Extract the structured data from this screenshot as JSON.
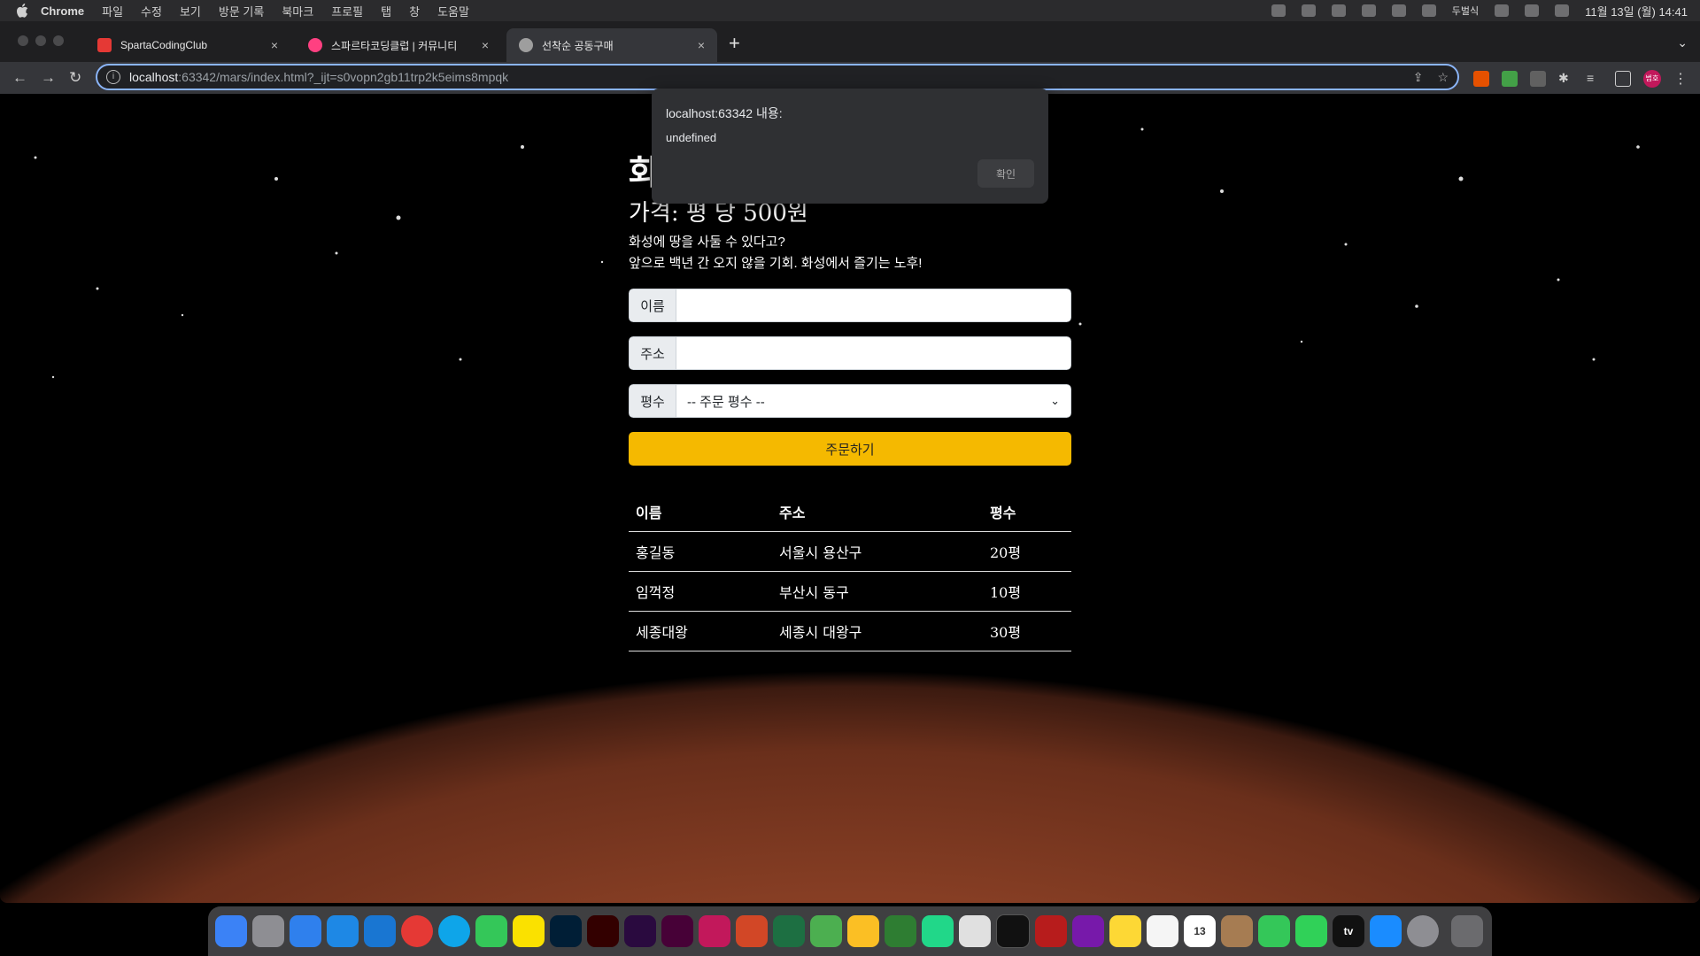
{
  "menubar": {
    "app": "Chrome",
    "items": [
      "파일",
      "수정",
      "보기",
      "방문 기록",
      "북마크",
      "프로필",
      "탭",
      "창",
      "도움말"
    ],
    "input_source": "두벌식",
    "clock": "11월 13일 (월) 14:41"
  },
  "tabs": [
    {
      "label": "SpartaCodingClub",
      "color": "#e53935"
    },
    {
      "label": "스파르타코딩클럽 | 커뮤니티",
      "color": "#ff4081"
    },
    {
      "label": "선착순 공동구매",
      "color": "#9e9e9e"
    }
  ],
  "omnibox": {
    "host": "localhost",
    "rest": ":63342/mars/index.html?_ijt=s0vopn2gb11trp2k5eims8mpqk"
  },
  "profile_badge": "범호",
  "page": {
    "title": "화",
    "price": "가격: 평 당 500원",
    "desc_line1": "화성에 땅을 사둘 수 있다고?",
    "desc_line2": "앞으로 백년 간 오지 않을 기회. 화성에서 즐기는 노후!",
    "form": {
      "name_label": "이름",
      "address_label": "주소",
      "size_label": "평수",
      "size_selected": "-- 주문 평수 --",
      "submit": "주문하기"
    },
    "table": {
      "headers": [
        "이름",
        "주소",
        "평수"
      ],
      "rows": [
        [
          "홍길동",
          "서울시 용산구",
          "20평"
        ],
        [
          "임꺽정",
          "부산시 동구",
          "10평"
        ],
        [
          "세종대왕",
          "세종시 대왕구",
          "30평"
        ]
      ]
    }
  },
  "dialog": {
    "title": "localhost:63342 내용:",
    "message": "undefined",
    "ok": "확인"
  },
  "dock": {
    "calendar_day": "13",
    "tv_label": "tv"
  },
  "colors": {
    "accent": "#f5b900",
    "omnibox_focus": "#8ab4f8"
  }
}
